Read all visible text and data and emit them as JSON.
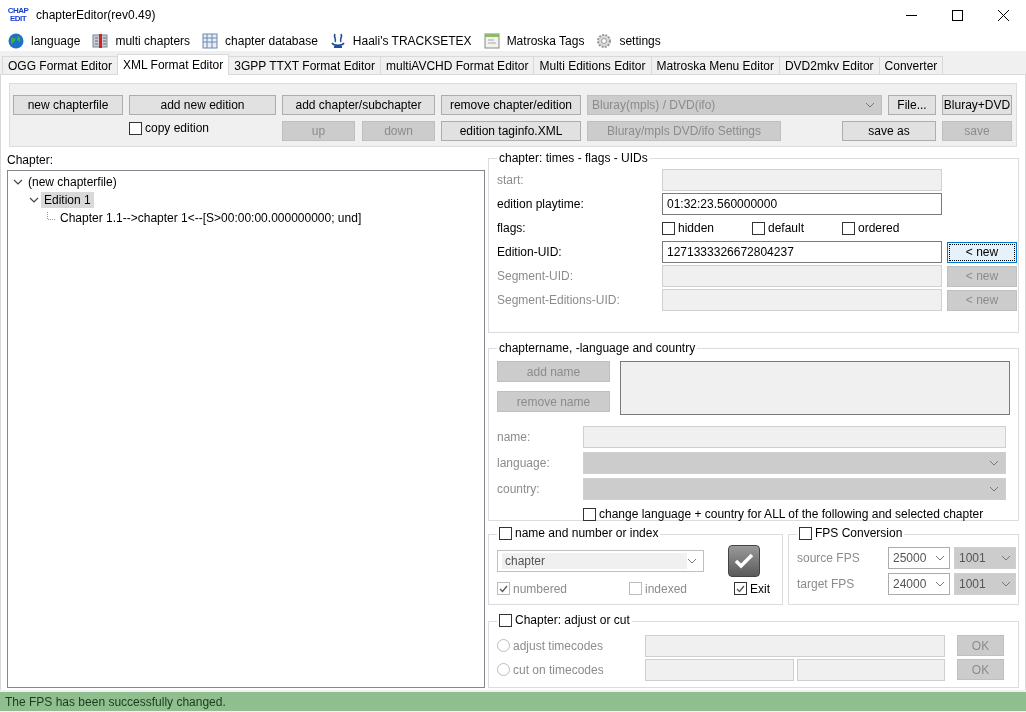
{
  "window": {
    "title": "chapterEditor(rev0.49)",
    "logo": "CHAP EDIT"
  },
  "menu": [
    {
      "label": "language"
    },
    {
      "label": "multi chapters"
    },
    {
      "label": "chapter database"
    },
    {
      "label": "Haali's TRACKSETEX"
    },
    {
      "label": "Matroska Tags"
    },
    {
      "label": "settings"
    }
  ],
  "tabs": [
    {
      "label": "OGG Format Editor",
      "selected": false
    },
    {
      "label": "XML Format Editor",
      "selected": true
    },
    {
      "label": "3GPP TTXT Format Editor",
      "selected": false
    },
    {
      "label": "multiAVCHD Format Editor",
      "selected": false
    },
    {
      "label": "Multi Editions Editor",
      "selected": false
    },
    {
      "label": "Matroska Menu Editor",
      "selected": false
    },
    {
      "label": "DVD2mkv Editor",
      "selected": false
    },
    {
      "label": "Converter",
      "selected": false
    }
  ],
  "toolbar": {
    "new_chapterfile": {
      "label": "new chapterfile",
      "disabled": false
    },
    "add_new_edition": {
      "label": "add new edition",
      "disabled": false
    },
    "copy_edition": {
      "label": "copy edition",
      "checked": false
    },
    "add_chapter": {
      "label": "add chapter/subchapter",
      "disabled": false
    },
    "up": {
      "label": "up",
      "disabled": true
    },
    "down": {
      "label": "down",
      "disabled": true
    },
    "remove": {
      "label": "remove chapter/edition",
      "disabled": false
    },
    "taginfo": {
      "label": "edition taginfo.XML",
      "disabled": false
    },
    "source_select": {
      "value": "Bluray(mpls) / DVD(ifo)",
      "disabled": true
    },
    "settings": {
      "label": "Bluray/mpls DVD/ifo Settings",
      "disabled": true
    },
    "file": {
      "label": "File...",
      "disabled": false
    },
    "bluray_dvd": {
      "label": "Bluray+DVD",
      "disabled": false
    },
    "save_as": {
      "label": "save as",
      "disabled": false
    },
    "save": {
      "label": "save",
      "disabled": true
    }
  },
  "chapter_tree": {
    "label": "Chapter:",
    "nodes": [
      {
        "label": "(new chapterfile)",
        "expanded": true,
        "selected": false,
        "children": [
          {
            "label": "Edition 1",
            "expanded": true,
            "selected": true,
            "children": [
              {
                "label": "Chapter 1.1-->chapter 1<--[S>00:00:00.000000000; und]",
                "selected": false
              }
            ]
          }
        ]
      }
    ]
  },
  "times_flags_uids": {
    "title": "chapter: times - flags - UIDs",
    "rows": [
      {
        "kind": "field",
        "label": "start:",
        "disabled": true
      },
      {
        "kind": "field",
        "label": "edition playtime:",
        "value": "01:32:23.560000000",
        "disabled": false
      },
      {
        "kind": "flags",
        "label": "flags:",
        "flags": [
          {
            "label": "hidden",
            "checked": false
          },
          {
            "label": "default",
            "checked": false
          },
          {
            "label": "ordered",
            "checked": false
          }
        ]
      },
      {
        "kind": "uid",
        "label": "Edition-UID:",
        "value": "1271333326672804237",
        "disabled": false,
        "button": {
          "label": "< new",
          "disabled": false,
          "focused": true
        }
      },
      {
        "kind": "uid",
        "label": "Segment-UID:",
        "disabled": true,
        "button": {
          "label": "< new",
          "disabled": true,
          "focused": false
        }
      },
      {
        "kind": "uid",
        "label": "Segment-Editions-UID:",
        "disabled": true,
        "button": {
          "label": "< new",
          "disabled": true,
          "focused": false
        }
      }
    ]
  },
  "chaptername": {
    "title": "chaptername, -language and country",
    "add_name": {
      "label": "add name",
      "disabled": true
    },
    "remove_name": {
      "label": "remove name",
      "disabled": true
    },
    "rows": [
      {
        "kind": "field",
        "label": "name:",
        "disabled": true
      },
      {
        "kind": "select",
        "label": "language:",
        "disabled": true
      },
      {
        "kind": "select",
        "label": "country:",
        "disabled": true
      }
    ],
    "apply_all": {
      "label": "change language + country for ALL of the following and selected chapter",
      "checked": false
    }
  },
  "numbering": {
    "title": "name and number or index",
    "checked": false,
    "name_select": {
      "value": "chapter"
    },
    "options": [
      {
        "label": "numbered",
        "checked": true,
        "disabled": true
      },
      {
        "label": "indexed",
        "checked": false,
        "disabled": true
      },
      {
        "label": "Exit",
        "checked": true,
        "disabled": false
      }
    ]
  },
  "fps": {
    "title": "FPS Conversion",
    "checked": false,
    "disabled": true,
    "rows": [
      {
        "label": "source FPS",
        "fps": "25000",
        "divisor": "1001"
      },
      {
        "label": "target FPS",
        "fps": "24000",
        "divisor": "1001"
      }
    ]
  },
  "adjust": {
    "title": "Chapter: adjust or cut",
    "checked": false,
    "disabled": true,
    "rows": [
      {
        "kind": "adjust",
        "label": "adjust timecodes",
        "selected": false,
        "button": "OK"
      },
      {
        "kind": "cut",
        "label": "cut on timecodes",
        "selected": false,
        "button": "OK"
      }
    ]
  },
  "status_bar": {
    "text": "The FPS has been successfully changed."
  }
}
